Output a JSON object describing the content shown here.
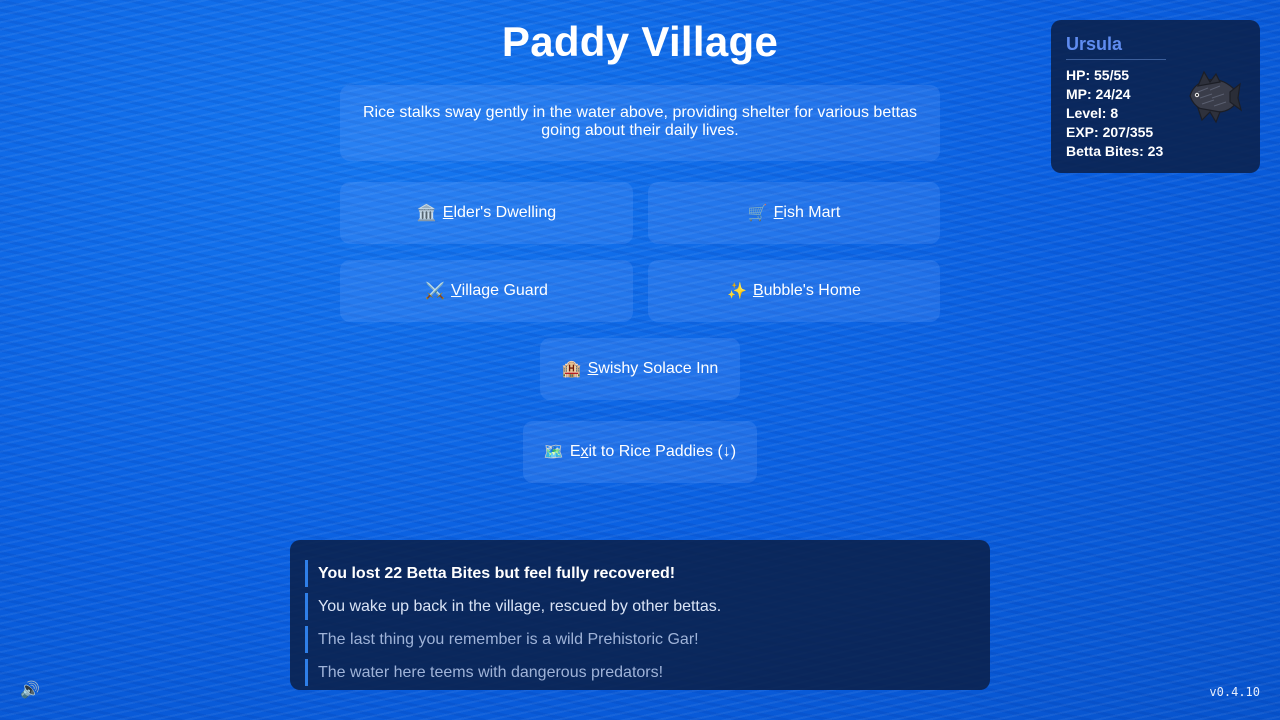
{
  "location": {
    "title": "Paddy Village",
    "description": "Rice stalks sway gently in the water above, providing shelter for various bettas going about their daily lives."
  },
  "destinations": [
    {
      "icon": "🏛️",
      "hotkey": "E",
      "rest": "lder's Dwelling"
    },
    {
      "icon": "🛒",
      "hotkey": "F",
      "rest": "ish Mart"
    },
    {
      "icon": "⚔️",
      "hotkey": "V",
      "rest": "illage Guard"
    },
    {
      "icon": "✨",
      "hotkey": "B",
      "rest": "ubble's Home"
    },
    {
      "icon": "🏨",
      "hotkey": "S",
      "rest": "wishy Solace Inn"
    }
  ],
  "exit": {
    "icon": "🗺️",
    "prefix": "E",
    "hotkey": "x",
    "rest": "it to Rice Paddies (↓)"
  },
  "player": {
    "name": "Ursula",
    "hp": "HP: 55/55",
    "mp": "MP: 24/24",
    "level": "Level: 8",
    "exp": "EXP: 207/355",
    "currency": "Betta Bites: 23"
  },
  "message_log": [
    "You lost 22 Betta Bites but feel fully recovered!",
    "You wake up back in the village, rescued by other bettas.",
    "The last thing you remember is a wild Prehistoric Gar!",
    "The water here teems with dangerous predators!"
  ],
  "footer": {
    "sound_icon": "🔊",
    "version": "v0.4.10"
  },
  "icons": {
    "player_sprite": "betta-fish-sprite-icon"
  }
}
